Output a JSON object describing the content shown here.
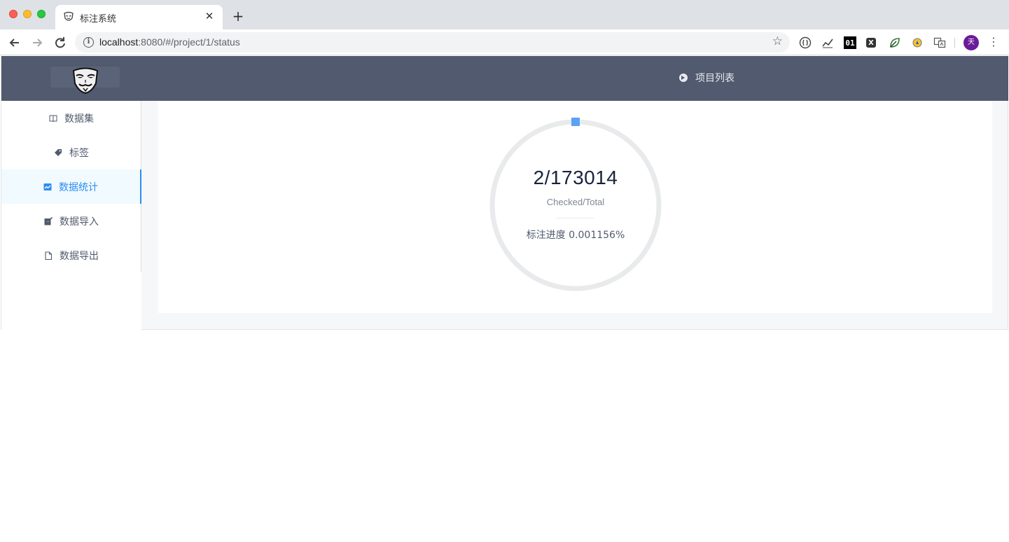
{
  "browser": {
    "tab_title": "标注系统",
    "tab_close": "✕",
    "new_tab": "+",
    "url_host": "localhost",
    "url_rest": ":8080/#/project/1/status",
    "avatar_letter": "天",
    "extensions": [
      "extension-bracket-icon",
      "extension-chart-icon",
      "extension-01-icon",
      "extension-x-icon",
      "extension-leaf-icon",
      "extension-compass-icon",
      "extension-translate-icon"
    ],
    "extension_texts": {
      "zero_one": "01",
      "x": "X"
    }
  },
  "header": {
    "project_list_label": "项目列表",
    "colors": {
      "background": "#515a6e"
    }
  },
  "sidebar": {
    "items": [
      {
        "label": "数据集",
        "icon": "book-icon",
        "active": false
      },
      {
        "label": "标签",
        "icon": "tag-icon",
        "active": false
      },
      {
        "label": "数据统计",
        "icon": "chart-icon",
        "active": true
      },
      {
        "label": "数据导入",
        "icon": "import-icon",
        "active": false
      },
      {
        "label": "数据导出",
        "icon": "file-icon",
        "active": false
      }
    ],
    "accent_color": "#2d8cf0"
  },
  "status": {
    "ratio_text": "2/173014",
    "caption": "Checked/Total",
    "progress_text": "标注进度 0.001156%",
    "checked": 2,
    "total": 173014,
    "progress_percent": 0.001156,
    "ring_color": "#e8eaec",
    "progress_color": "#2d8cf0"
  }
}
